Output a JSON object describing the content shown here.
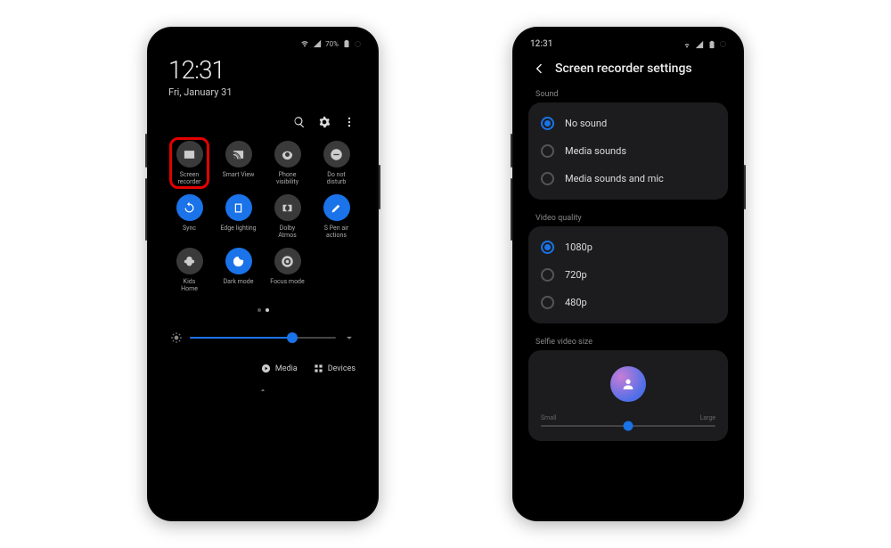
{
  "left": {
    "status": {
      "time": "12:31",
      "battery": "70%"
    },
    "clock": {
      "time": "12:31",
      "date": "Fri, January 31"
    },
    "brightness_pct": 70,
    "tiles": [
      {
        "label": "Screen\nrecorder",
        "active": false,
        "highlighted": true,
        "icon": "record"
      },
      {
        "label": "Smart View",
        "active": false,
        "icon": "cast"
      },
      {
        "label": "Phone\nvisibility",
        "active": false,
        "icon": "visibility"
      },
      {
        "label": "Do not\ndisturb",
        "active": false,
        "icon": "dnd"
      },
      {
        "label": "Sync",
        "active": true,
        "icon": "sync"
      },
      {
        "label": "Edge lighting",
        "active": true,
        "icon": "edge"
      },
      {
        "label": "Dolby\nAtmos",
        "active": false,
        "icon": "dolby"
      },
      {
        "label": "S Pen air\nactions",
        "active": true,
        "icon": "spen"
      },
      {
        "label": "Kids\nHome",
        "active": false,
        "icon": "kids"
      },
      {
        "label": "Dark mode",
        "active": true,
        "icon": "dark"
      },
      {
        "label": "Focus mode",
        "active": false,
        "icon": "focus"
      }
    ],
    "bottom": {
      "media": "Media",
      "devices": "Devices"
    }
  },
  "right": {
    "status": {
      "time": "12:31"
    },
    "title": "Screen recorder settings",
    "sections": {
      "sound": {
        "label": "Sound",
        "options": [
          {
            "label": "No sound",
            "selected": true
          },
          {
            "label": "Media sounds",
            "selected": false
          },
          {
            "label": "Media sounds and mic",
            "selected": false
          }
        ]
      },
      "quality": {
        "label": "Video quality",
        "options": [
          {
            "label": "1080p",
            "selected": true
          },
          {
            "label": "720p",
            "selected": false
          },
          {
            "label": "480p",
            "selected": false
          }
        ]
      },
      "selfie": {
        "label": "Selfie video size",
        "small": "Small",
        "large": "Large"
      }
    }
  }
}
